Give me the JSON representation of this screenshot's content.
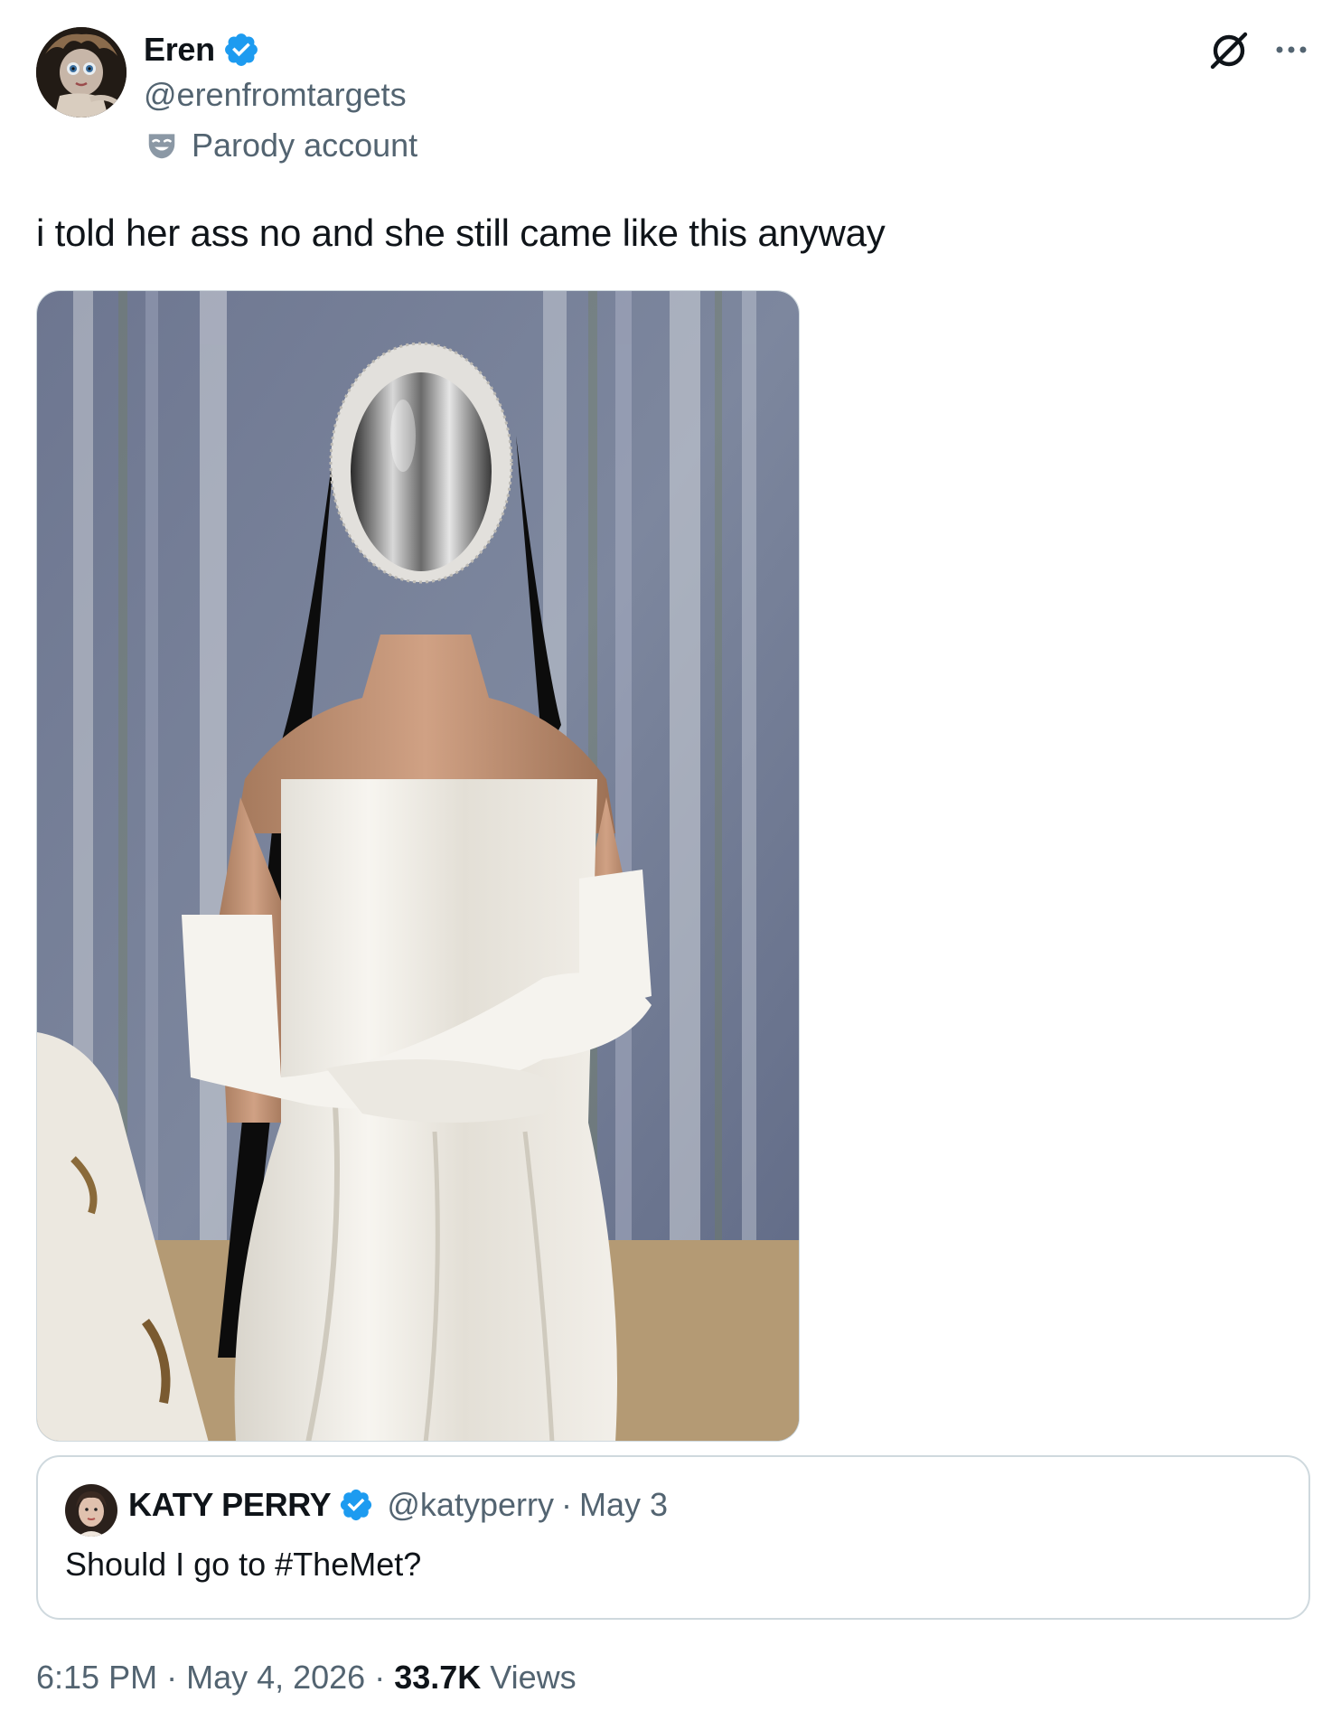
{
  "author": {
    "display_name": "Eren",
    "handle": "@erenfromtargets",
    "parody_label": "Parody account",
    "verified_color": "#1d9bf0"
  },
  "header": {
    "grok_icon": "grok-icon",
    "more_icon": "more-horizontal-icon"
  },
  "tweet": {
    "text": "i told her ass no and she still came like this anyway",
    "media_alt": "Person in white strapless gown, long white gloves and chrome face mask against a textured blue backdrop"
  },
  "quote": {
    "display_name": "KATY PERRY",
    "handle": "@katyperry",
    "separator": "·",
    "date": "May 3",
    "text": "Should I go to #TheMet?"
  },
  "footer": {
    "time": "6:15 PM",
    "date": "May 4, 2026",
    "separator": "·",
    "views_count": "33.7K",
    "views_label": "Views"
  },
  "colors": {
    "text_primary": "#0f1419",
    "text_secondary": "#536471",
    "border": "#cfd9de",
    "accent": "#1d9bf0"
  }
}
